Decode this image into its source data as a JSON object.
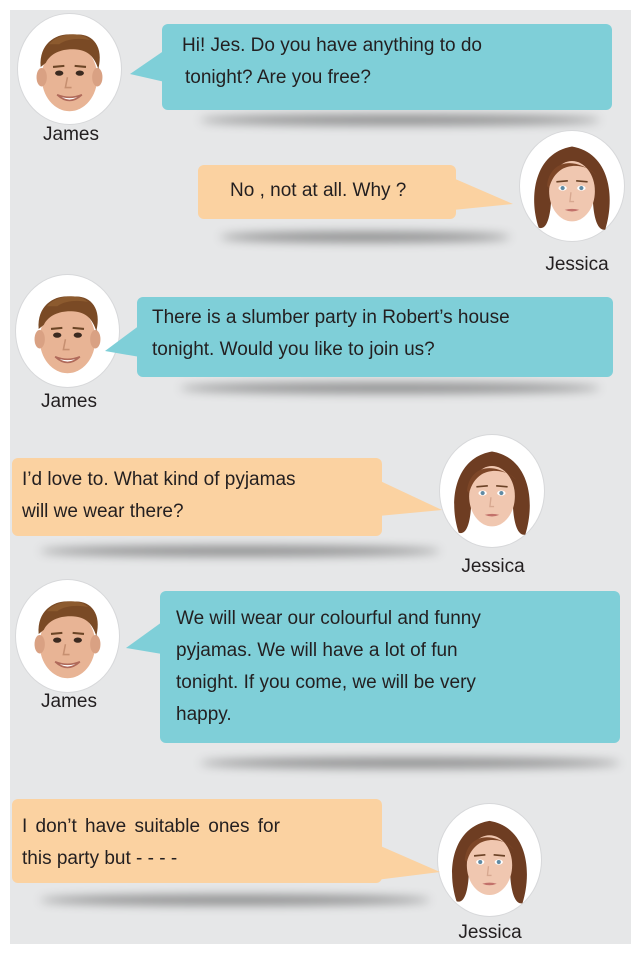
{
  "colors": {
    "background": "#e6e7e8",
    "james_bubble": "#7fcfd8",
    "jessica_bubble": "#fbd2a1",
    "text": "#231f20"
  },
  "messages": [
    {
      "speaker": "James",
      "avatar_icon": "james-portrait-icon",
      "lines": [
        "Hi! Jes. Do you have anything to do",
        "tonight? Are you free?"
      ]
    },
    {
      "speaker": "Jessica",
      "avatar_icon": "jessica-portrait-icon",
      "lines": [
        "No , not at all. Why ?"
      ]
    },
    {
      "speaker": "James",
      "avatar_icon": "james-portrait-icon",
      "lines": [
        "There is a slumber party in Robert’s house",
        "tonight. Would you like to join us?"
      ]
    },
    {
      "speaker": "Jessica",
      "avatar_icon": "jessica-portrait-icon",
      "lines": [
        "I’d love to. What kind of  pyjamas",
        "will we wear there?"
      ]
    },
    {
      "speaker": "James",
      "avatar_icon": "james-portrait-icon",
      "lines": [
        "We will wear our colourful and funny",
        "pyjamas. We will have  a lot of fun",
        "tonight.  If you come, we will be very",
        "happy."
      ]
    },
    {
      "speaker": "Jessica",
      "avatar_icon": "jessica-portrait-icon",
      "lines": [
        "I don’t have suitable ones for",
        "this party but - - - -"
      ]
    }
  ]
}
